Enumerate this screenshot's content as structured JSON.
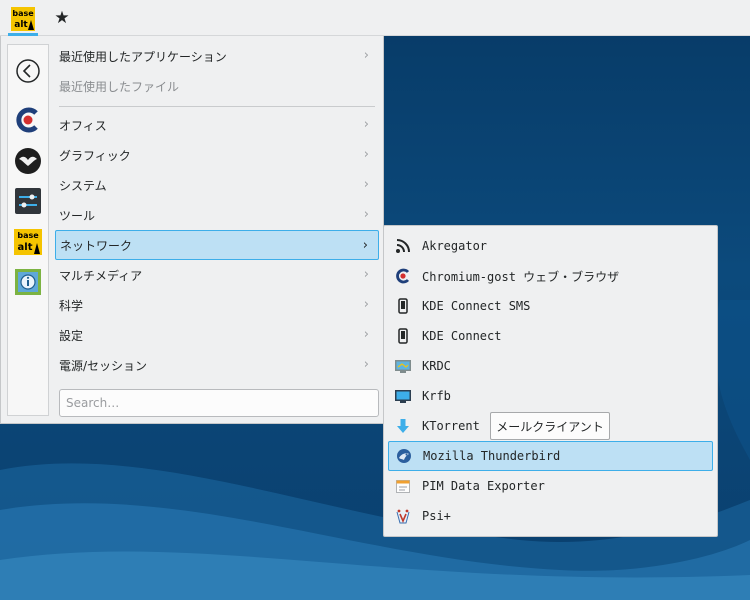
{
  "panel": {
    "launcher_logo_top": "base",
    "launcher_logo_bottom": "alt",
    "star_icon": "star-icon"
  },
  "favorites": [
    {
      "name": "back",
      "icon": "back-arrow-icon"
    },
    {
      "name": "chromium-gost",
      "icon": "chromium-gost-icon"
    },
    {
      "name": "thunderbird-like",
      "icon": "bird-icon"
    },
    {
      "name": "settings",
      "icon": "sliders-icon"
    },
    {
      "name": "basealt",
      "icon": "basealt-logo-icon",
      "logo_top": "base",
      "logo_bottom": "alt"
    },
    {
      "name": "info",
      "icon": "info-icon"
    }
  ],
  "menu": {
    "recent_apps": "最近使用したアプリケーション",
    "recent_files": "最近使用したファイル",
    "categories": [
      "オフィス",
      "グラフィック",
      "システム",
      "ツール",
      "ネットワーク",
      "マルチメディア",
      "科学",
      "設定",
      "電源/セッション"
    ],
    "search_placeholder": "Search…"
  },
  "submenu": {
    "items": [
      {
        "label": "Akregator",
        "icon": "rss-icon"
      },
      {
        "label": "Chromium-gost ウェブ・ブラウザ",
        "icon": "chromium-gost-icon"
      },
      {
        "label": "KDE Connect SMS",
        "icon": "phone-icon"
      },
      {
        "label": "KDE Connect",
        "icon": "phone-icon"
      },
      {
        "label": "KRDC",
        "icon": "remote-desktop-icon"
      },
      {
        "label": "Krfb",
        "icon": "desktop-share-icon"
      },
      {
        "label": "KTorrent",
        "icon": "download-arrow-icon"
      },
      {
        "label": "Mozilla Thunderbird",
        "icon": "thunderbird-icon"
      },
      {
        "label": "PIM Data Exporter",
        "icon": "calendar-export-icon"
      },
      {
        "label": "Psi+",
        "icon": "psi-icon"
      }
    ],
    "tooltip": "メールクライアント"
  },
  "colors": {
    "accent": "#3daee9",
    "highlight": "#bde0f4",
    "panel_bg": "#eff0f1",
    "wallpaper": "#0b3d6b"
  }
}
